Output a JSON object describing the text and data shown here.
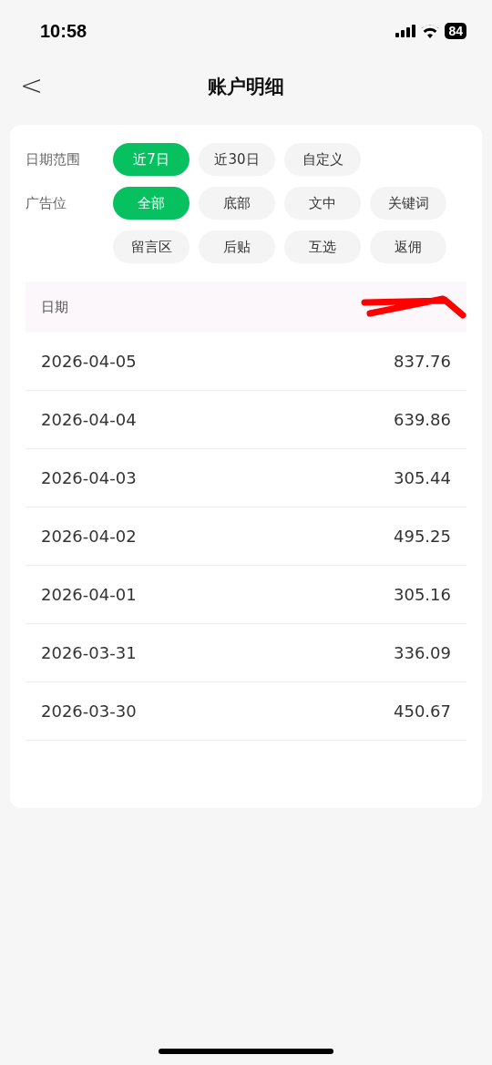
{
  "status_bar": {
    "time": "10:58",
    "battery": "84"
  },
  "nav": {
    "back": "<",
    "title": "账户明细"
  },
  "filters": [
    {
      "label": "日期范围",
      "options": [
        {
          "label": "近7日",
          "selected": true
        },
        {
          "label": "近30日",
          "selected": false
        },
        {
          "label": "自定义",
          "selected": false
        }
      ]
    },
    {
      "label": "广告位",
      "options": [
        {
          "label": "全部",
          "selected": true
        },
        {
          "label": "底部",
          "selected": false
        },
        {
          "label": "文中",
          "selected": false
        },
        {
          "label": "关键词",
          "selected": false
        },
        {
          "label": "留言区",
          "selected": false
        },
        {
          "label": "后贴",
          "selected": false
        },
        {
          "label": "互选",
          "selected": false
        },
        {
          "label": "返佣",
          "selected": false
        }
      ]
    }
  ],
  "table": {
    "columns": [
      "日期"
    ],
    "rows": [
      {
        "date": "2026-04-05",
        "amount": "837.76"
      },
      {
        "date": "2026-04-04",
        "amount": "639.86"
      },
      {
        "date": "2026-04-03",
        "amount": "305.44"
      },
      {
        "date": "2026-04-02",
        "amount": "495.25"
      },
      {
        "date": "2026-04-01",
        "amount": "305.16"
      },
      {
        "date": "2026-03-31",
        "amount": "336.09"
      },
      {
        "date": "2026-03-30",
        "amount": "450.67"
      }
    ]
  }
}
